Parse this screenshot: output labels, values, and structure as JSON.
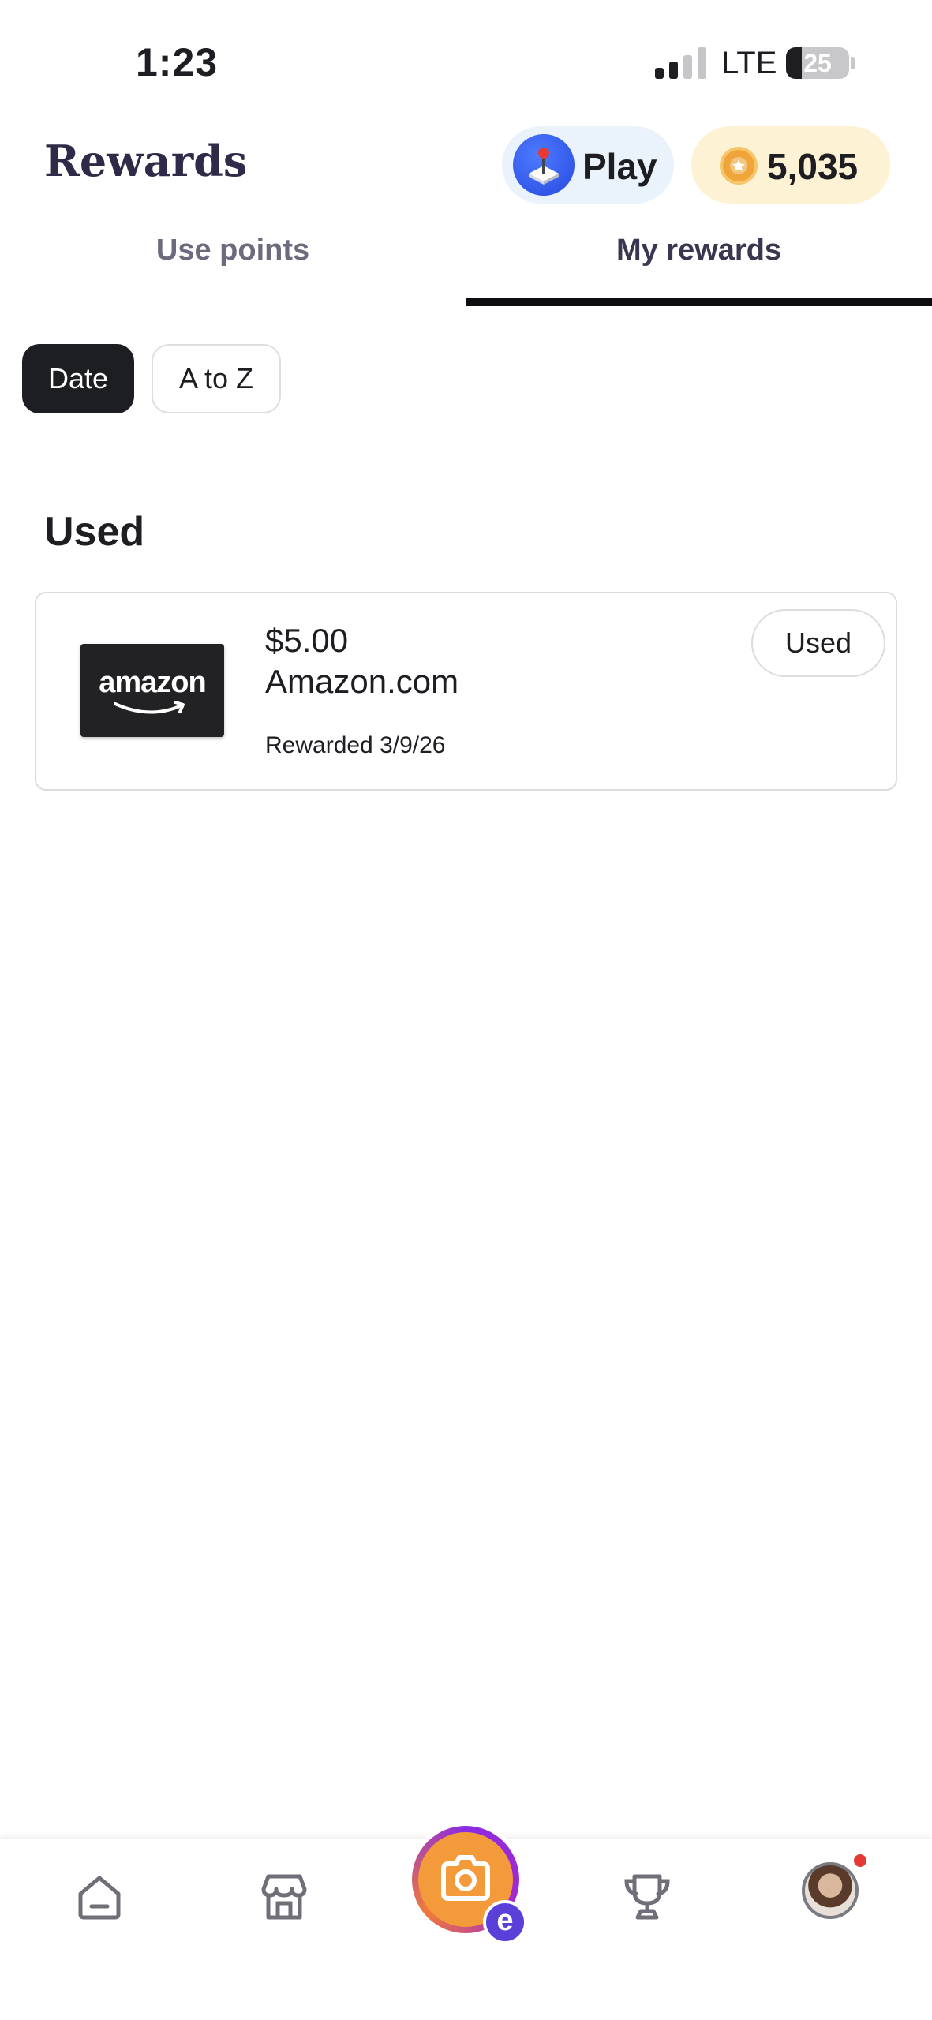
{
  "status_bar": {
    "time": "1:23",
    "carrier": "LTE",
    "battery": "25",
    "battery_level": 0.25
  },
  "header": {
    "title": "Rewards",
    "play_label": "Play",
    "points": "5,035"
  },
  "tabs": [
    {
      "label": "Use points",
      "active": false
    },
    {
      "label": "My rewards",
      "active": true
    }
  ],
  "filters": {
    "date_label": "Date",
    "az_label": "A to Z",
    "selected": "Date"
  },
  "section": {
    "title": "Used"
  },
  "rewards": [
    {
      "brand_logo": "amazon",
      "amount": "$5.00",
      "merchant": "Amazon.com",
      "date_text": "Rewarded 3/9/26",
      "status": "Used"
    }
  ],
  "bottom_nav": {
    "items": [
      "home-icon",
      "store-icon",
      "camera-icon",
      "trophy-icon",
      "avatar"
    ],
    "camera_badge": "e"
  },
  "colors": {
    "title": "#2f2a48",
    "play_bg": "#eaf2fb",
    "points_bg": "#fdf3d4",
    "coin": "#f0a53a",
    "active_chip": "#1d1e22",
    "tab_underline": "#0e0e10",
    "camera_orange": "#f39a3b",
    "camera_ring": "#8a2be2",
    "notification": "#e53935"
  }
}
